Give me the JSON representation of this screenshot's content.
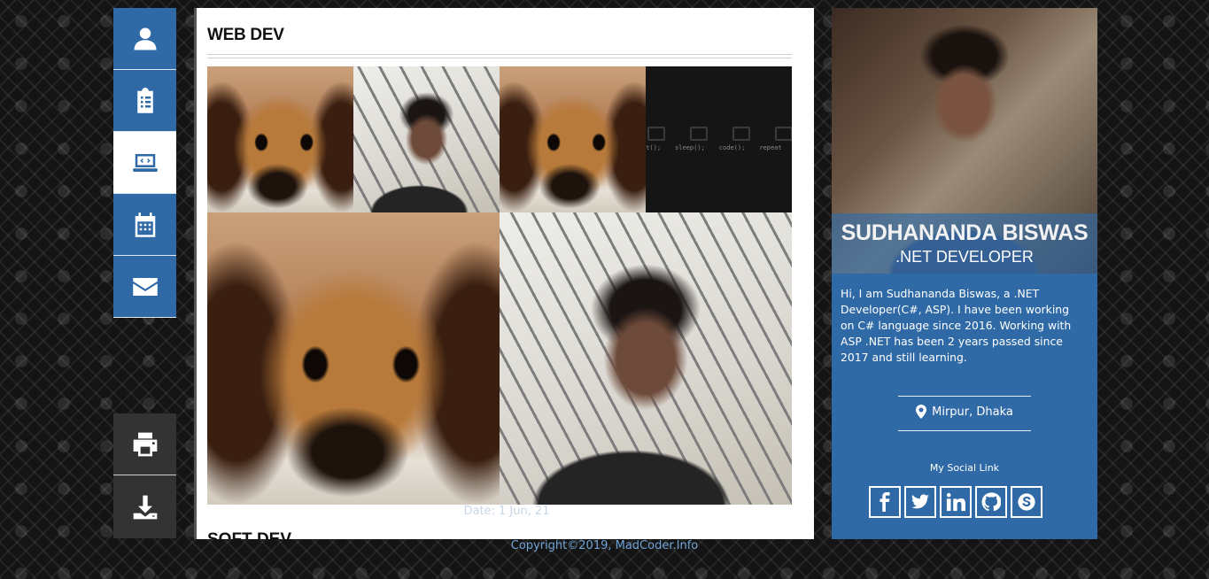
{
  "nav": {
    "items": [
      {
        "icon": "user-icon",
        "active": false
      },
      {
        "icon": "clipboard-icon",
        "active": false
      },
      {
        "icon": "laptop-code-icon",
        "active": true
      },
      {
        "icon": "calendar-icon",
        "active": false
      },
      {
        "icon": "envelope-icon",
        "active": false
      }
    ],
    "tools": [
      {
        "icon": "print-icon"
      },
      {
        "icon": "download-icon"
      }
    ]
  },
  "main": {
    "section_title": "WEB DEV",
    "gallery": [
      {
        "subject": "dachshund-dog-photo"
      },
      {
        "subject": "selfie-photo"
      },
      {
        "subject": "dachshund-dog-photo"
      },
      {
        "subject": "code-icons-photo",
        "code_labels": [
          "at();",
          "sleep();",
          "code();",
          "repeat"
        ]
      },
      {
        "subject": "dachshund-dog-photo"
      },
      {
        "subject": "selfie-photo"
      }
    ],
    "date": "Date: 1 Jun, 21",
    "next_section_title": "SOFT DEV"
  },
  "profile": {
    "name": "SUDHANANDA BISWAS",
    "role": ".NET DEVELOPER",
    "bio": "Hi, I am Sudhananda Biswas, a .NET Developer(C#, ASP). I have been working on C# language since 2016. Working with ASP .NET has been 2 years passed since 2017 and still learning.",
    "location": "Mirpur, Dhaka",
    "social_title": "My Social Link",
    "social": [
      "facebook-icon",
      "twitter-icon",
      "linkedin-icon",
      "github-icon",
      "skype-icon"
    ]
  },
  "footer": {
    "copyright": "Copyright©2019, MadCoder.Info"
  },
  "colors": {
    "accent": "#2f6aa6",
    "tool_bg": "#333333",
    "copyright": "#6fa4d8"
  }
}
